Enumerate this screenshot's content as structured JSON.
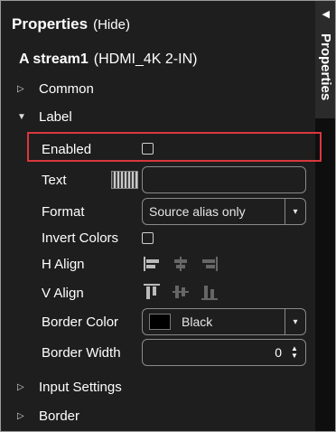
{
  "panel": {
    "title": "Properties",
    "hide_link": "(Hide)",
    "side_tab": "Properties"
  },
  "stream": {
    "name": "A stream1",
    "source": "(HDMI_4K 2-IN)"
  },
  "sections": {
    "common": "Common",
    "label": "Label",
    "input_settings": "Input Settings",
    "border": "Border"
  },
  "label_props": {
    "enabled_label": "Enabled",
    "enabled_checked": false,
    "text_label": "Text",
    "text_value": "",
    "format_label": "Format",
    "format_value": "Source alias only",
    "invert_label": "Invert Colors",
    "invert_checked": false,
    "halign_label": "H Align",
    "valign_label": "V Align",
    "border_color_label": "Border Color",
    "border_color_value": "Black",
    "border_color_hex": "#000000",
    "border_width_label": "Border Width",
    "border_width_value": "0"
  },
  "colors": {
    "panel_bg": "#1e1e1e",
    "highlight": "#d9373d"
  }
}
